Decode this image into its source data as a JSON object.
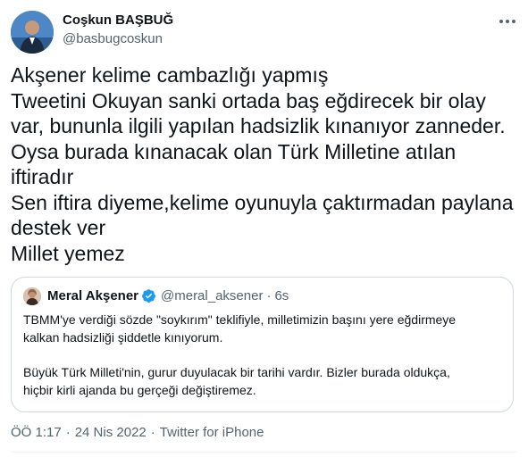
{
  "author": {
    "name": "Coşkun BAŞBUĞ",
    "handle": "@basbugcoskun"
  },
  "tweet": {
    "lines": [
      "Akşener kelime cambazlığı yapmış",
      "Tweetini Okuyan sanki ortada baş eğdirecek bir olay",
      "var, bununla ilgili yapılan hadsizlik kınanıyor zanneder.",
      "Oysa burada kınanacak olan Türk Milletine atılan",
      "iftiradır",
      "Sen iftira diyeme,kelime oyunuyla çaktırmadan paylana",
      "destek ver",
      "Millet yemez"
    ]
  },
  "quote": {
    "name": "Meral Akşener",
    "handle": "@meral_aksener",
    "separator": "·",
    "time": "6s",
    "paragraph1": [
      "TBMM'ye verdiği sözde \"soykırım\" teklifiyle, milletimizin başını yere eğdirmeye",
      "kalkan hadsizliği şiddetle kınıyorum."
    ],
    "paragraph2": [
      "Büyük Türk Milleti'nin, gurur duyulacak bir tarihi vardır. Bizler burada oldukça,",
      "hiçbir kirli ajanda bu gerçeği değiştiremez."
    ]
  },
  "meta": {
    "time": "ÖÖ 1:17",
    "date": "24 Nis 2022",
    "source": "Twitter for iPhone",
    "separator": "·"
  },
  "colors": {
    "text": "#0f1419",
    "secondary": "#536471",
    "border": "#cfd9de",
    "verified": "#1d9bf0"
  },
  "icons": {
    "more": "more-horizontal-icon",
    "verified": "verified-badge-icon"
  }
}
